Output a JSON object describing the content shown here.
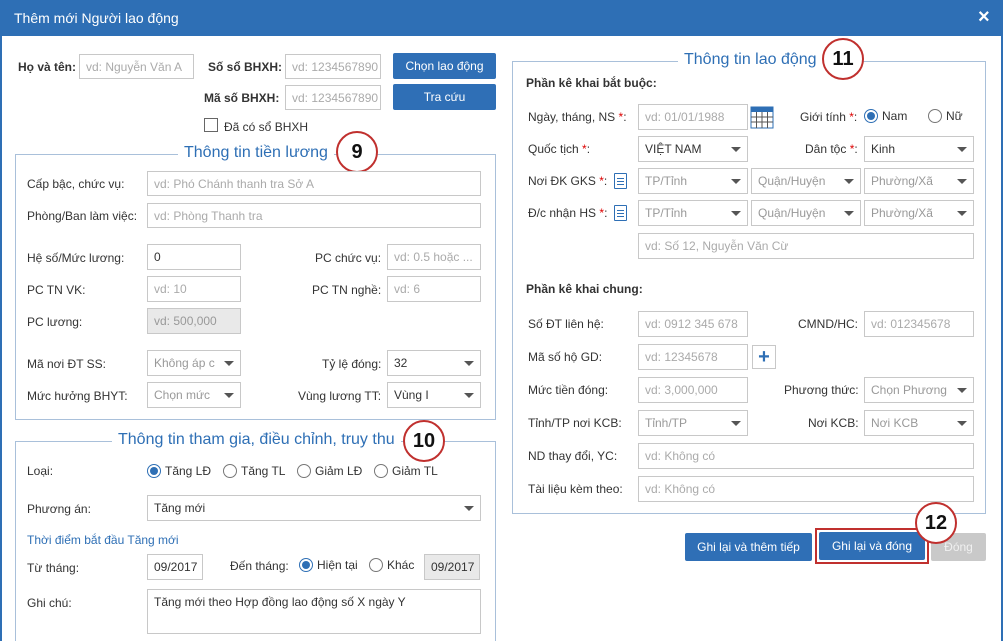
{
  "window": {
    "title": "Thêm mới Người lao động",
    "close": "×"
  },
  "top": {
    "ho_ten_label": "Họ và tên:",
    "ho_ten_ph": "vd: Nguyễn Văn A",
    "so_bhxh_label": "Số sổ BHXH:",
    "so_bhxh_ph": "vd: 1234567890",
    "ma_bhxh_label": "Mã số BHXH:",
    "ma_bhxh_ph": "vd: 1234567890",
    "chon_btn": "Chọn lao động",
    "tracuu_btn": "Tra cứu",
    "da_co_so": "Đã có sổ BHXH"
  },
  "salary": {
    "title": "Thông tin tiền lương",
    "badge": "9",
    "cap_bac_label": "Cấp bậc, chức vụ:",
    "cap_bac_ph": "vd: Phó Chánh thanh tra Sở A",
    "phong_ban_label": "Phòng/Ban làm việc:",
    "phong_ban_ph": "vd: Phòng Thanh tra",
    "he_so_label": "Hệ số/Mức lương:",
    "he_so_val": "0",
    "pc_chuc_vu_label": "PC chức vụ:",
    "pc_chuc_vu_ph": "vd: 0.5 hoặc ...",
    "pc_tn_vk_label": "PC TN VK:",
    "pc_tn_vk_ph": "vd: 10",
    "pc_tn_nghe_label": "PC TN nghề:",
    "pc_tn_nghe_ph": "vd: 6",
    "pc_luong_label": "PC lương:",
    "pc_luong_ph": "vd: 500,000",
    "ma_noi_label": "Mã nơi ĐT SS:",
    "ma_noi_val": "Không áp c",
    "ty_le_label": "Tỷ lệ đóng:",
    "ty_le_val": "32",
    "muc_huong_label": "Mức hưởng BHYT:",
    "muc_huong_val": "Chọn mức",
    "vung_luong_label": "Vùng lương TT:",
    "vung_luong_val": "Vùng I"
  },
  "participation": {
    "title": "Thông tin tham gia, điều chỉnh, truy thu",
    "badge": "10",
    "loai_label": "Loại:",
    "loai_options": [
      "Tăng LĐ",
      "Tăng TL",
      "Giảm LĐ",
      "Giảm TL"
    ],
    "phuong_an_label": "Phương án:",
    "phuong_an_val": "Tăng mới",
    "thoi_diem": "Thời điểm bắt đầu Tăng mới",
    "tu_thang_label": "Từ tháng:",
    "tu_thang_val": "09/2017",
    "den_thang_label": "Đến tháng:",
    "hien_tai": "Hiện tại",
    "khac": "Khác",
    "den_thang_val": "09/2017",
    "ghi_chu_label": "Ghi chú:",
    "ghi_chu_val": "Tăng mới theo Hợp đồng lao động số X ngày Y"
  },
  "labor": {
    "title": "Thông tin lao động",
    "badge": "11",
    "mandatory": "Phần kê khai bắt buộc:",
    "ngay_sinh_label": "Ngày, tháng, NS",
    "ngay_sinh_ph": "vd: 01/01/1988",
    "gioi_tinh_label": "Giới tính",
    "nam": "Nam",
    "nu": "Nữ",
    "quoc_tich_label": "Quốc tịch",
    "quoc_tich_val": "VIỆT NAM",
    "dan_toc_label": "Dân tộc",
    "dan_toc_val": "Kinh",
    "noi_dk_label": "Nơi ĐK GKS",
    "dc_nhan_label": "Đ/c nhận HS",
    "tinh_ph": "TP/Tỉnh",
    "huyen_ph": "Quận/Huyện",
    "xa_ph": "Phường/Xã",
    "dia_chi_ph": "vd: Số 12, Nguyễn Văn Cừ",
    "general": "Phần kê khai chung:",
    "sdt_label": "Số ĐT liên hệ:",
    "sdt_ph": "vd: 0912 345 678",
    "cmnd_label": "CMND/HC:",
    "cmnd_ph": "vd: 012345678",
    "ma_ho_label": "Mã số hộ GD:",
    "ma_ho_ph": "vd: 12345678",
    "muc_tien_label": "Mức tiền đóng:",
    "muc_tien_ph": "vd: 3,000,000",
    "phuong_thuc_label": "Phương thức:",
    "phuong_thuc_ph": "Chọn Phương",
    "tinh_kcb_label": "Tỉnh/TP nơi KCB:",
    "tinh_kcb_ph": "Tỉnh/TP",
    "noi_kcb_label": "Nơi KCB:",
    "noi_kcb_ph": "Nơi KCB",
    "nd_thay_doi_label": "ND thay đổi, YC:",
    "nd_thay_doi_ph": "vd: Không có",
    "tai_lieu_label": "Tài liệu kèm theo:",
    "tai_lieu_ph": "vd: Không có",
    "req_mark": "*",
    "colon": ":"
  },
  "actions": {
    "save_next": "Ghi lại và thêm tiếp",
    "save_close": "Ghi lại và đóng",
    "close": "Đóng",
    "badge": "12"
  }
}
